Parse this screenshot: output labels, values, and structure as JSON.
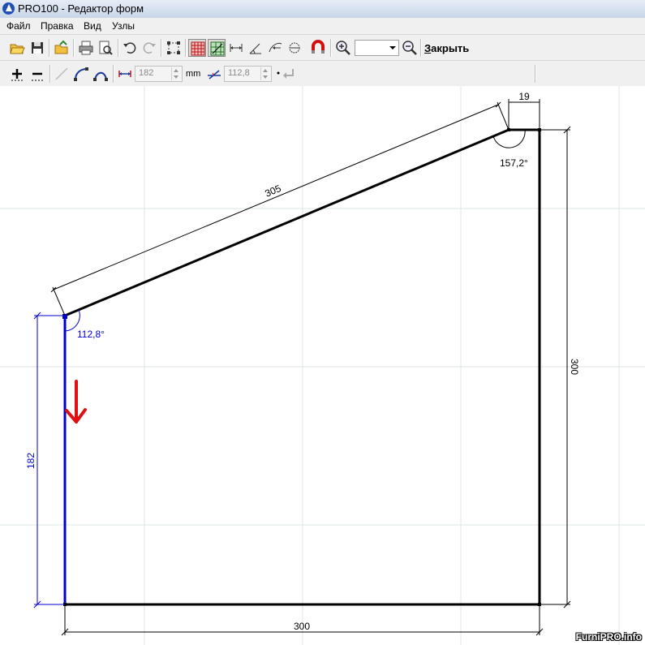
{
  "window": {
    "title": "PRO100 - Редактор форм"
  },
  "menu": [
    "Файл",
    "Правка",
    "Вид",
    "Узлы"
  ],
  "toolbar": {
    "close_label": "Закрыть",
    "zoom_value": "",
    "length_value": "182",
    "length_unit": "mm",
    "angle_value": "112,8"
  },
  "drawing": {
    "dim_top_edge": "305",
    "dim_top_short": "19",
    "dim_right": "300",
    "dim_bottom": "300",
    "dim_left": "182",
    "angle_top_right": "157,2°",
    "angle_left": "112,8°"
  },
  "colors": {
    "selected_edge": "#0000cc",
    "edge": "#000000",
    "grid": "#dde6e6",
    "arrow": "#e01010"
  },
  "watermark": "FurniPRO.info"
}
